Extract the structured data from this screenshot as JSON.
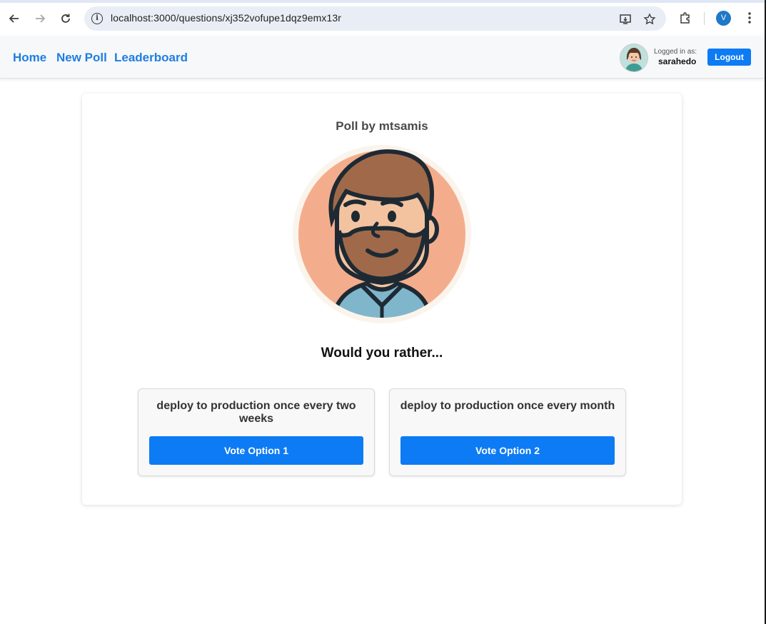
{
  "browser": {
    "url": "localhost:3000/questions/xj352vofupe1dqz9emx13r",
    "profile_initial": "V",
    "icons": [
      "back-icon",
      "forward-icon",
      "reload-icon",
      "site-info-icon",
      "install-app-icon",
      "bookmark-star-icon",
      "extensions-icon",
      "menu-kebab-icon"
    ]
  },
  "nav": {
    "links": [
      "Home",
      "New Poll",
      "Leaderboard"
    ],
    "logged_in_label": "Logged in as:",
    "username": "sarahedo",
    "logout_label": "Logout"
  },
  "poll": {
    "author_heading": "Poll by mtsamis",
    "question": "Would you rather...",
    "options": [
      {
        "text": "deploy to production once every two weeks",
        "button": "Vote Option 1"
      },
      {
        "text": "deploy to production once every month",
        "button": "Vote Option 2"
      }
    ]
  },
  "colors": {
    "accent": "#0d7bf4",
    "link": "#1e7ee3"
  }
}
